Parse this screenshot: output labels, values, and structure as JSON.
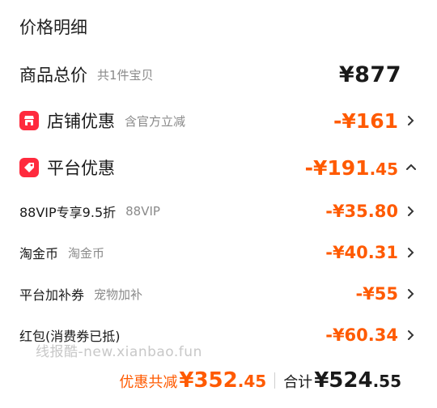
{
  "title": "价格明细",
  "total": {
    "label": "商品总价",
    "hint": "共1件宝贝",
    "amount": "¥877"
  },
  "shop_discount": {
    "label": "店铺优惠",
    "hint": "含官方立减",
    "amount": "-¥161",
    "icon": "store-icon",
    "icon_color": "#ff2a3d"
  },
  "platform_discount": {
    "label": "平台优惠",
    "amount_main": "-¥191",
    "amount_dec": ".45",
    "icon": "tag-icon",
    "expand_icon": "chevron-up-icon"
  },
  "items": [
    {
      "label": "88VIP专享9.5折",
      "hint": "88VIP",
      "amount": "-¥35.80"
    },
    {
      "label": "淘金币",
      "hint": "淘金币",
      "amount": "-¥40.31"
    },
    {
      "label": "平台加补券",
      "hint": "宠物加补",
      "amount": "-¥55"
    },
    {
      "label": "红包(消费券已抵)",
      "hint": "",
      "amount": "-¥60.34"
    }
  ],
  "watermark": "线报酷-new.xianbao.fun",
  "summary": {
    "discount_label": "优惠共减",
    "discount_main": "¥352",
    "discount_dec": ".45",
    "total_label": "合计",
    "total_main": "¥524",
    "total_dec": ".55"
  },
  "colors": {
    "accent": "#ff5a00",
    "icon_red": "#ff2a3d",
    "hint_gray": "#8a8a8a"
  }
}
